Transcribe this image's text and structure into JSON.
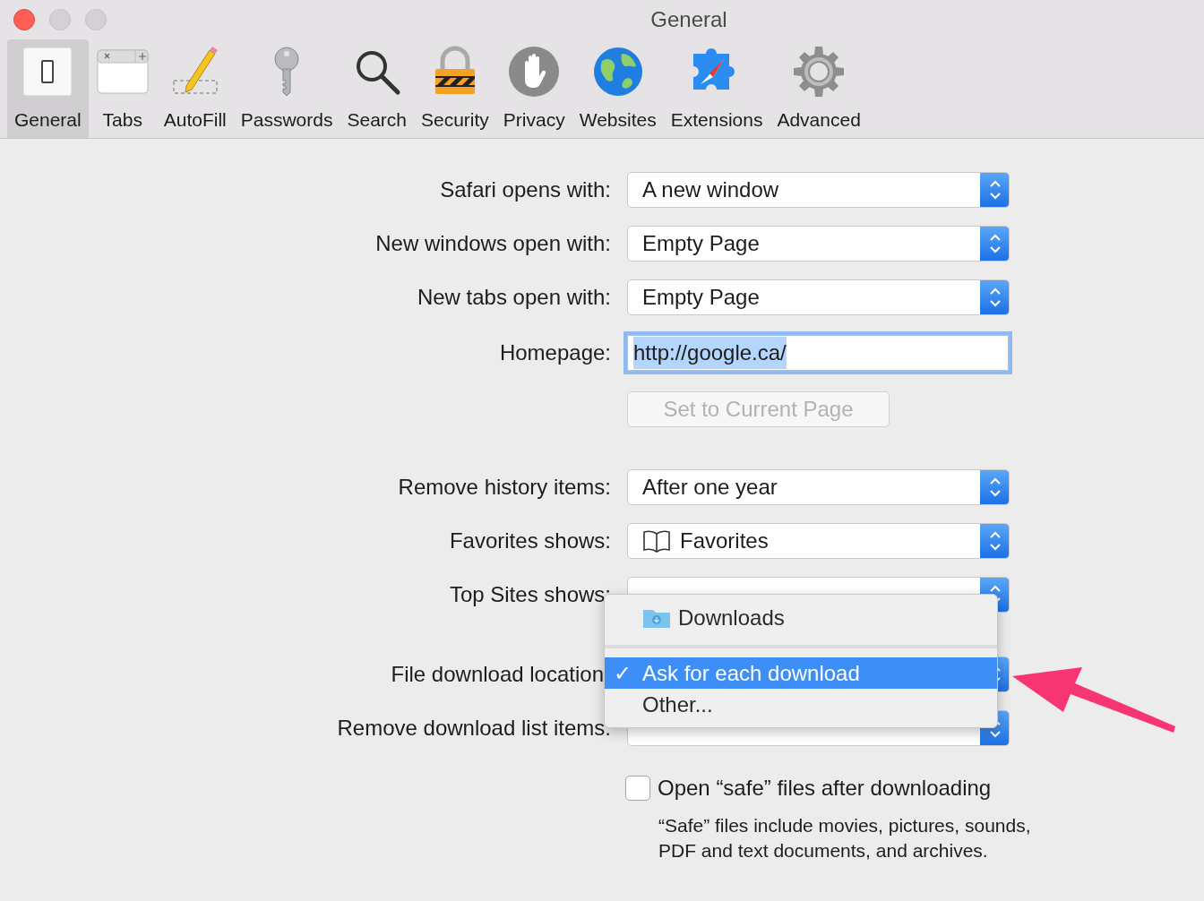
{
  "window": {
    "title": "General"
  },
  "toolbar": {
    "tabs": [
      {
        "label": "General",
        "selected": true
      },
      {
        "label": "Tabs",
        "selected": false
      },
      {
        "label": "AutoFill",
        "selected": false
      },
      {
        "label": "Passwords",
        "selected": false
      },
      {
        "label": "Search",
        "selected": false
      },
      {
        "label": "Security",
        "selected": false
      },
      {
        "label": "Privacy",
        "selected": false
      },
      {
        "label": "Websites",
        "selected": false
      },
      {
        "label": "Extensions",
        "selected": false
      },
      {
        "label": "Advanced",
        "selected": false
      }
    ]
  },
  "sections": [
    {
      "rows": [
        {
          "kind": "select",
          "label": "Safari opens with:",
          "value": "A new window"
        },
        {
          "kind": "select",
          "label": "New windows open with:",
          "value": "Empty Page"
        },
        {
          "kind": "select",
          "label": "New tabs open with:",
          "value": "Empty Page"
        },
        {
          "kind": "field",
          "label": "Homepage:",
          "value": "http://google.ca/",
          "focused": true
        },
        {
          "kind": "button",
          "value": "Set to Current Page",
          "disabled": true
        }
      ]
    },
    {
      "rows": [
        {
          "kind": "select",
          "label": "Remove history items:",
          "value": "After one year"
        },
        {
          "kind": "bookmark-select",
          "label": "Favorites shows:",
          "value": "Favorites"
        },
        {
          "kind": "select",
          "label": "Top Sites shows:"
        }
      ]
    },
    {
      "rows": [
        {
          "kind": "select",
          "label": "File download location"
        },
        {
          "kind": "select",
          "label": "Remove download list items:"
        }
      ]
    }
  ],
  "checkbox": {
    "label": "Open “safe” files after downloading",
    "checked": false,
    "note": "“Safe” files include movies, pictures, sounds, PDF and text documents, and archives."
  },
  "menu": {
    "items": [
      {
        "kind": "folder",
        "label": "Downloads",
        "selected": false
      },
      {
        "kind": "separator"
      },
      {
        "kind": "item",
        "mark": "✓",
        "label": "Ask for each download",
        "selected": true
      },
      {
        "kind": "item",
        "label": "Other...",
        "selected": false
      }
    ]
  }
}
